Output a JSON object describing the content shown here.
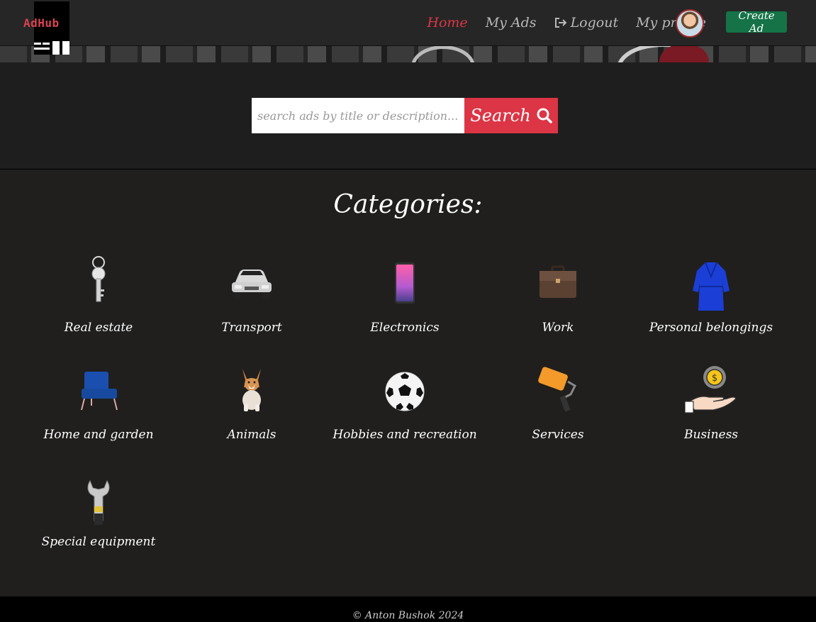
{
  "header": {
    "logo_text": "AdHub",
    "nav": {
      "home": "Home",
      "my_ads": "My Ads",
      "logout": "Logout",
      "my_profile": "My profile"
    },
    "create_ad": "Create Ad"
  },
  "search": {
    "placeholder": "search ads by title or description...",
    "button": "Search"
  },
  "categories": {
    "title": "Categories:",
    "items": [
      {
        "label": "Real estate",
        "icon": "key-icon"
      },
      {
        "label": "Transport",
        "icon": "car-icon"
      },
      {
        "label": "Electronics",
        "icon": "smartphone-icon"
      },
      {
        "label": "Work",
        "icon": "briefcase-icon"
      },
      {
        "label": "Personal belongings",
        "icon": "robe-icon"
      },
      {
        "label": "Home and garden",
        "icon": "armchair-icon"
      },
      {
        "label": "Animals",
        "icon": "dog-icon"
      },
      {
        "label": "Hobbies and recreation",
        "icon": "soccer-ball-icon"
      },
      {
        "label": "Services",
        "icon": "paint-roller-icon"
      },
      {
        "label": "Business",
        "icon": "money-hand-icon"
      },
      {
        "label": "Special equipment",
        "icon": "wrench-icon"
      }
    ]
  },
  "footer": {
    "copyright": "© Anton Bushok 2024"
  },
  "colors": {
    "accent": "#dc3545",
    "create_button": "#157347",
    "background": "#201f1e"
  }
}
